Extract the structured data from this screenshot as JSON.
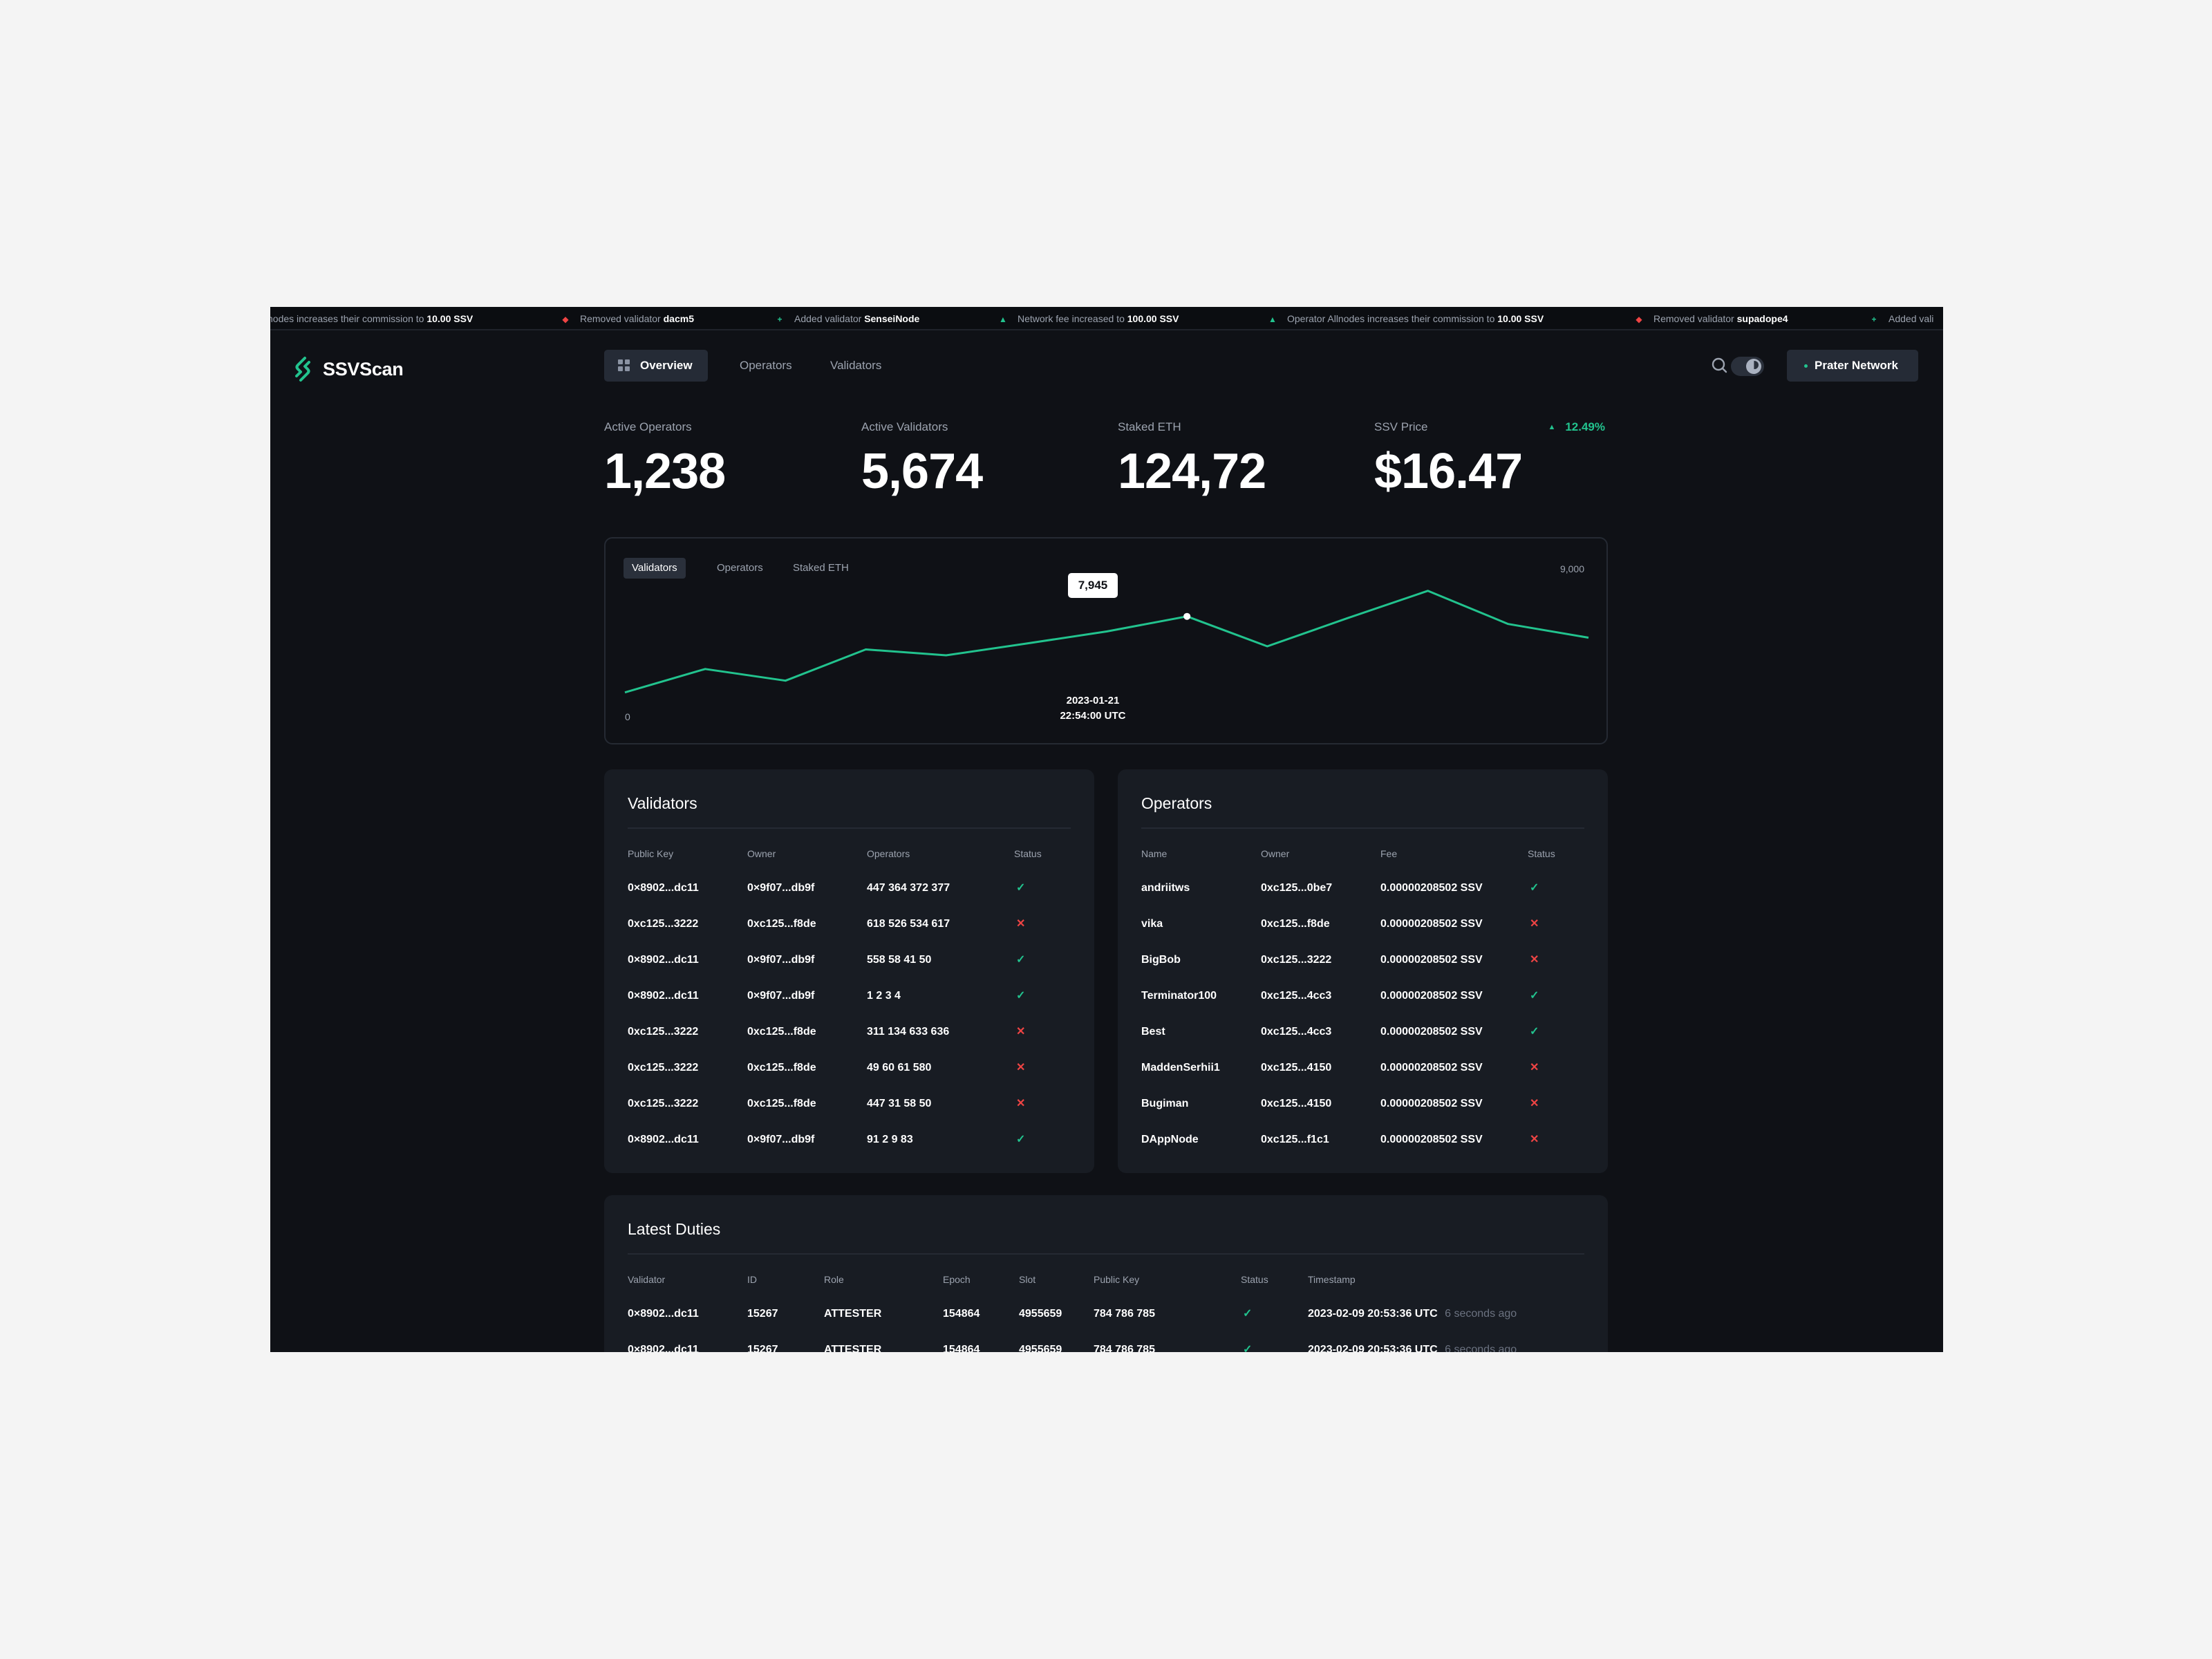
{
  "ticker": [
    {
      "icon": "",
      "text": "nodes increases their commission to ",
      "bold": "10.00 SSV",
      "status": "up"
    },
    {
      "icon": "diamond",
      "text": "Removed validator ",
      "bold": "dacm5",
      "status": "removed"
    },
    {
      "icon": "plus",
      "text": "Added validator ",
      "bold": "SenseiNode",
      "status": "added"
    },
    {
      "icon": "up",
      "text": "Network fee increased to ",
      "bold": "100.00 SSV",
      "status": "up"
    },
    {
      "icon": "up",
      "text": "Operator Allnodes increases their commission to ",
      "bold": "10.00 SSV",
      "status": "up"
    },
    {
      "icon": "diamond",
      "text": "Removed validator ",
      "bold": "supadope4",
      "status": "removed"
    },
    {
      "icon": "plus",
      "text": "Added vali",
      "bold": "",
      "status": "added"
    }
  ],
  "brand": {
    "name": "SSVScan",
    "color": "#22c38e"
  },
  "nav": {
    "overview": "Overview",
    "operators": "Operators",
    "validators": "Validators"
  },
  "network": "Prater Network",
  "stats": [
    {
      "label": "Active Operators",
      "value": "1,238"
    },
    {
      "label": "Active Validators",
      "value": "5,674"
    },
    {
      "label": "Staked ETH",
      "value": "124,72"
    },
    {
      "label": "SSV Price",
      "value": "$16.47",
      "change": "12.49%"
    }
  ],
  "chart": {
    "tabs": [
      "Validators",
      "Operators",
      "Staked ETH"
    ],
    "active_tab": "Validators",
    "y_max_label": "9,000",
    "y_min_label": "0",
    "tooltip_value": "7,945",
    "tooltip_date": "2023-01-21",
    "tooltip_time": "22:54:00 UTC",
    "line_color": "#22c38e"
  },
  "chart_data": {
    "type": "line",
    "ylim": [
      0,
      9000
    ],
    "series": [
      {
        "values": [
          6000,
          6600,
          6300,
          7100,
          6950,
          7250,
          7560,
          7945,
          7180,
          7900,
          8600,
          7750,
          7400
        ]
      }
    ],
    "highlight_index": 7
  },
  "validators": {
    "title": "Validators",
    "columns": [
      "Public Key",
      "Owner",
      "Operators",
      "Status"
    ],
    "rows": [
      {
        "key": "0×8902...dc11",
        "owner": "0×9f07...db9f",
        "operators": "447 364 372 377",
        "ok": true
      },
      {
        "key": "0xc125...3222",
        "owner": "0xc125...f8de",
        "operators": "618 526 534 617",
        "ok": false
      },
      {
        "key": "0×8902...dc11",
        "owner": "0×9f07...db9f",
        "operators": "558 58 41 50",
        "ok": true
      },
      {
        "key": "0×8902...dc11",
        "owner": "0×9f07...db9f",
        "operators": "1 2 3 4",
        "ok": true
      },
      {
        "key": "0xc125...3222",
        "owner": "0xc125...f8de",
        "operators": "311 134 633 636",
        "ok": false
      },
      {
        "key": "0xc125...3222",
        "owner": "0xc125...f8de",
        "operators": "49 60 61 580",
        "ok": false
      },
      {
        "key": "0xc125...3222",
        "owner": "0xc125...f8de",
        "operators": "447 31 58 50",
        "ok": false
      },
      {
        "key": "0×8902...dc11",
        "owner": "0×9f07...db9f",
        "operators": "91 2 9 83",
        "ok": true
      }
    ]
  },
  "operators": {
    "title": "Operators",
    "columns": [
      "Name",
      "Owner",
      "Fee",
      "Status"
    ],
    "rows": [
      {
        "name": "andriitws",
        "owner": "0xc125...0be7",
        "fee": "0.00000208502 SSV",
        "ok": true
      },
      {
        "name": "vika",
        "owner": "0xc125...f8de",
        "fee": "0.00000208502 SSV",
        "ok": false
      },
      {
        "name": "BigBob",
        "owner": "0xc125...3222",
        "fee": "0.00000208502 SSV",
        "ok": false
      },
      {
        "name": "Terminator100",
        "owner": "0xc125...4cc3",
        "fee": "0.00000208502 SSV",
        "ok": true
      },
      {
        "name": "Best",
        "owner": "0xc125...4cc3",
        "fee": "0.00000208502 SSV",
        "ok": true
      },
      {
        "name": "MaddenSerhii1",
        "owner": "0xc125...4150",
        "fee": "0.00000208502 SSV",
        "ok": false
      },
      {
        "name": "Bugiman",
        "owner": "0xc125...4150",
        "fee": "0.00000208502 SSV",
        "ok": false
      },
      {
        "name": "DAppNode",
        "owner": "0xc125...f1c1",
        "fee": "0.00000208502 SSV",
        "ok": false
      }
    ]
  },
  "duties": {
    "title": "Latest Duties",
    "columns": [
      "Validator",
      "ID",
      "Role",
      "Epoch",
      "Slot",
      "Public Key",
      "Status",
      "Timestamp"
    ],
    "rows": [
      {
        "validator": "0×8902...dc11",
        "id": "15267",
        "role": "ATTESTER",
        "epoch": "154864",
        "slot": "4955659",
        "pubkey": "784 786 785",
        "ok": true,
        "timestamp": "2023-02-09 20:53:36 UTC",
        "ago": "6 seconds ago"
      },
      {
        "validator": "0×8902...dc11",
        "id": "15267",
        "role": "ATTESTER",
        "epoch": "154864",
        "slot": "4955659",
        "pubkey": "784 786 785",
        "ok": true,
        "timestamp": "2023-02-09 20:53:36 UTC",
        "ago": "6 seconds ago"
      }
    ]
  },
  "status_symbols": {
    "ok": "✓",
    "bad": "✕"
  },
  "colors": {
    "background": "#0f1116",
    "card": "#181c23",
    "success": "#22c38e",
    "error": "#ef4444"
  }
}
